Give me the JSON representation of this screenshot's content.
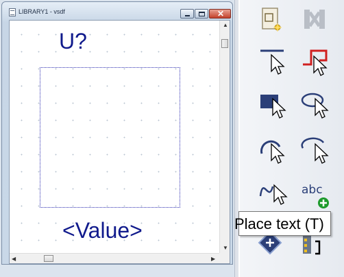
{
  "window": {
    "title": "LIBRARY1 - vsdf",
    "buttons": {
      "minimize_icon": "minimize-icon",
      "maximize_icon": "maximize-icon",
      "close_icon": "close-icon"
    }
  },
  "canvas": {
    "reference_designator": "U?",
    "part_value": "<Value>"
  },
  "palette": {
    "tools": [
      {
        "icon": "new-part-icon"
      },
      {
        "icon": "delete-icon"
      },
      {
        "icon": "place-line-icon"
      },
      {
        "icon": "place-polyline-icon"
      },
      {
        "icon": "place-rectangle-icon"
      },
      {
        "icon": "place-ellipse-icon"
      },
      {
        "icon": "place-arc-icon"
      },
      {
        "icon": "place-elliptical-arc-icon"
      },
      {
        "icon": "place-bezier-icon"
      },
      {
        "icon": "place-text-icon",
        "label": "abc"
      },
      {
        "icon": "place-ieee-symbol-icon"
      },
      {
        "icon": "place-pin-array-icon"
      }
    ],
    "tooltip": "Place text (T)"
  },
  "colors": {
    "text_blue": "#101a8c",
    "outline_dotted": "#2b2bb0",
    "tool_navy": "#2b3f78",
    "tool_red": "#d02020"
  }
}
